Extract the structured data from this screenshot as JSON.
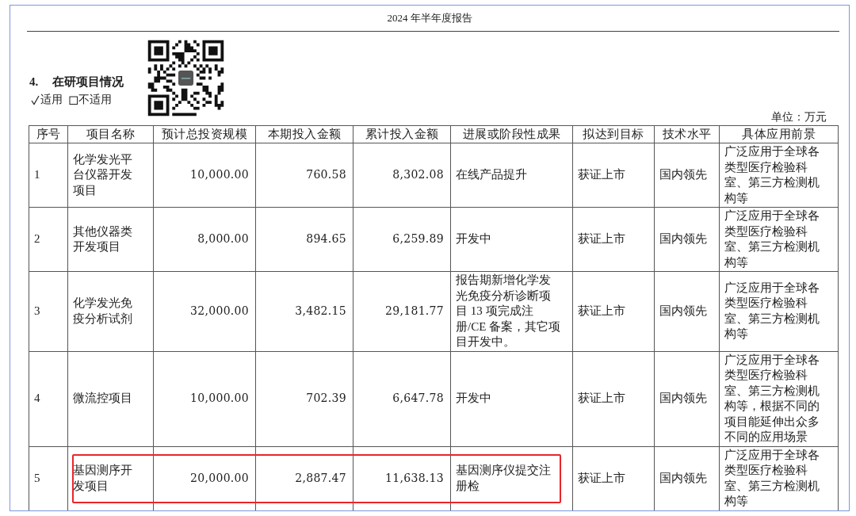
{
  "header": {
    "title": "2024 年半年度报告"
  },
  "section": {
    "number": "4.",
    "title": "在研项目情况",
    "options": [
      {
        "label": "适用",
        "checked": true
      },
      {
        "label": "不适用",
        "checked": false
      }
    ]
  },
  "unit": "单位：万元",
  "table": {
    "columns": [
      "序号",
      "项目名称",
      "预计总投资规模",
      "本期投入金额",
      "累计投入金额",
      "进展或阶段性成果",
      "拟达到目标",
      "技术水平",
      "具体应用前景"
    ],
    "rows": [
      {
        "no": "1",
        "name": "化学发光平台仪器开发项目",
        "budget": "10,000.00",
        "current": "760.58",
        "cumulative": "8,302.08",
        "progress": "在线产品提升",
        "target": "获证上市",
        "level": "国内领先",
        "prospect": "广泛应用于全球各类型医疗检验科室、第三方检测机构等",
        "highlighted": false
      },
      {
        "no": "2",
        "name": "其他仪器类开发项目",
        "budget": "8,000.00",
        "current": "894.65",
        "cumulative": "6,259.89",
        "progress": "开发中",
        "target": "获证上市",
        "level": "国内领先",
        "prospect": "广泛应用于全球各类型医疗检验科室、第三方检测机构等",
        "highlighted": false
      },
      {
        "no": "3",
        "name": "化学发光免疫分析试剂",
        "budget": "32,000.00",
        "current": "3,482.15",
        "cumulative": "29,181.77",
        "progress": "报告期新增化学发光免疫分析诊断项目 13 项完成注册/CE 备案，其它项目开发中。",
        "target": "获证上市",
        "level": "国内领先",
        "prospect": "广泛应用于全球各类型医疗检验科室、第三方检测机构等",
        "highlighted": false
      },
      {
        "no": "4",
        "name": "微流控项目",
        "budget": "10,000.00",
        "current": "702.39",
        "cumulative": "6,647.78",
        "progress": "开发中",
        "target": "获证上市",
        "level": "国内领先",
        "prospect": "广泛应用于全球各类型医疗检验科室、第三方检测机构等，根据不同的项目能延伸出众多不同的应用场景",
        "highlighted": false
      },
      {
        "no": "5",
        "name": "基因测序开发项目",
        "budget": "20,000.00",
        "current": "2,887.47",
        "cumulative": "11,638.13",
        "progress": "基因测序仪提交注册检",
        "target": "获证上市",
        "level": "国内领先",
        "prospect": "广泛应用于全球各类型医疗检验科室、第三方检测机构等",
        "highlighted": true
      }
    ]
  }
}
